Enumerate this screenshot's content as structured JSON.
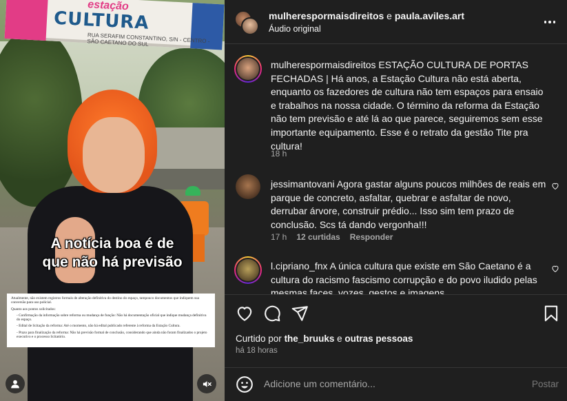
{
  "media": {
    "sign_script": "estação",
    "sign_title": "CULTURA",
    "sign_address": "RUA SERAFIM CONSTANTINO, S/N - CENTRO - SÃO CAETANO DO SUL",
    "overlay_line1": "A notícia boa é de",
    "overlay_line2": "que não há previsão",
    "document": {
      "p1": "Atualmente, não existem registros formais de alteração definitiva do destino do espaço, tampouco documentos que indiquem sua conversão para uso policial.",
      "p2": "Quanto aos pontos solicitados:",
      "items": [
        "- Confirmação da informação sobre reforma ou mudança de função: Não há documentação oficial que indique mudança definitiva do espaço.",
        "- Edital de licitação da reforma: Até o momento, não há edital publicado referente à reforma da Estação Cultura.",
        "- Prazo para finalização da reforma: Não há previsão formal de conclusão, considerando que ainda não foram finalizados o projeto executivo e o processo licitatório."
      ]
    }
  },
  "header": {
    "user1": "mulherespormaisdireitos",
    "conj": "e",
    "user2": "paula.aviles.art",
    "audio": "Áudio original"
  },
  "post": {
    "username": "mulherespormaisdireitos",
    "caption": "ESTAÇÃO CULTURA DE PORTAS FECHADAS | Há anos, a Estação Cultura não está aberta, enquanto os fazedores de cultura não tem espaços para ensaio e trabalhos na nossa cidade. O término da reforma da Estação não tem previsão e até lá ao que parece, seguiremos sem esse importante equipamento. Esse é o retrato da gestão Tite pra cultura!",
    "time": "18 h"
  },
  "comments": [
    {
      "username": "jessimantovani",
      "text": "Agora gastar alguns poucos milhões de reais em parque de concreto, asfaltar, quebrar e asfaltar de novo, derrubar árvore, construir prédio... Isso sim tem prazo de conclusão. Scs tá dando vergonha!!!",
      "time": "17 h",
      "likes": "12 curtidas",
      "reply": "Responder"
    },
    {
      "username": "l.cipriano_fnx",
      "text": "A única cultura que existe em São Caetano é a cultura do racismo fascismo corrupção e do povo iludido pelas mesmas faces ,vozes ,gestos e imagens"
    }
  ],
  "likes": {
    "prefix": "Curtido por",
    "user": "the_bruuks",
    "mid": "e",
    "others": "outras pessoas"
  },
  "time_ago": "há 18 horas",
  "composer": {
    "placeholder": "Adicione um comentário...",
    "post_label": "Postar"
  },
  "colors": {
    "panel_bg": "#1f1f1f",
    "text": "#f5f5f5",
    "secondary": "#a8a8a8",
    "divider": "#363636",
    "hair": "#ff7a2a",
    "sign_pink": "#e23c86",
    "sign_blue": "#1f5a8c"
  },
  "icons": [
    "heart-icon",
    "comment-icon",
    "share-icon",
    "bookmark-icon",
    "emoji-icon",
    "more-icon",
    "user-tag-icon",
    "mute-icon"
  ]
}
